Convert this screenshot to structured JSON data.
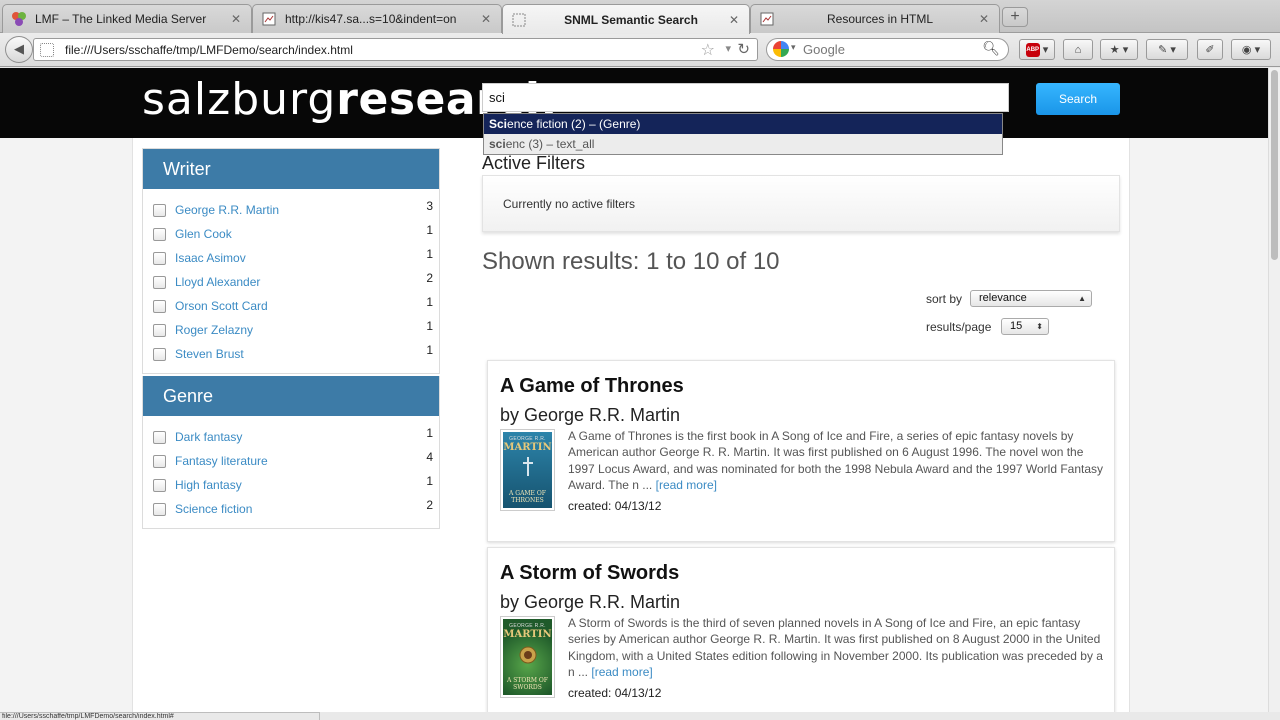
{
  "browser": {
    "tabs": [
      {
        "title": "LMF – The Linked Media Server",
        "favicon": "lmf-icon"
      },
      {
        "title": "http://kis47.sa...s=10&indent=on",
        "favicon": "page-icon"
      },
      {
        "title": "SNML Semantic Search",
        "favicon": "blank-page-icon"
      },
      {
        "title": "Resources in HTML",
        "favicon": "page-icon"
      }
    ],
    "url": "file:///Users/sschaffe/tmp/LMFDemo/search/index.html",
    "search_engine_placeholder": "Google",
    "status_text": "file:///Users/sschaffe/tmp/LMFDemo/search/index.html#"
  },
  "header": {
    "logo_light": "salzburg",
    "logo_bold": "research",
    "query": "sci",
    "search_label": "Search"
  },
  "autocomplete": [
    {
      "match": "Sci",
      "rest": "ence fiction (2) – (Genre)"
    },
    {
      "match": "sci",
      "rest": "enc (3) – text_all"
    }
  ],
  "facets": [
    {
      "title": "Writer",
      "items": [
        {
          "label": "George R.R. Martin",
          "count": "3"
        },
        {
          "label": "Glen Cook",
          "count": "1"
        },
        {
          "label": "Isaac Asimov",
          "count": "1"
        },
        {
          "label": "Lloyd Alexander",
          "count": "2"
        },
        {
          "label": "Orson Scott Card",
          "count": "1"
        },
        {
          "label": "Roger Zelazny",
          "count": "1"
        },
        {
          "label": "Steven Brust",
          "count": "1"
        }
      ]
    },
    {
      "title": "Genre",
      "items": [
        {
          "label": "Dark fantasy",
          "count": "1"
        },
        {
          "label": "Fantasy literature",
          "count": "4"
        },
        {
          "label": "High fantasy",
          "count": "1"
        },
        {
          "label": "Science fiction",
          "count": "2"
        }
      ]
    }
  ],
  "active_filters": {
    "title": "Active Filters",
    "empty_text": "Currently no active filters"
  },
  "results_summary": "Shown results: 1 to 10 of 10",
  "sort": {
    "label": "sort by",
    "value": "relevance"
  },
  "per_page": {
    "label": "results/page",
    "value": "15"
  },
  "results": [
    {
      "title": "A Game of Thrones",
      "author": "by George R.R. Martin",
      "cover": {
        "top": "GEORGE R.R.",
        "name": "MARTIN",
        "sub": "A GAME OF THRONES",
        "color": "#1e6e91"
      },
      "description": "A Game of Thrones is the first book in A Song of Ice and Fire, a series of epic fantasy novels by American author George R. R. Martin. It was first published on 6 August 1996. The novel won the 1997 Locus Award, and was nominated for both the 1998 Nebula Award and the 1997 World Fantasy Award. The n ...",
      "read_more": "[read more]",
      "created": "created: 04/13/12"
    },
    {
      "title": "A Storm of Swords",
      "author": "by George R.R. Martin",
      "cover": {
        "top": "GEORGE R.R.",
        "name": "MARTIN",
        "sub": "A STORM OF SWORDS",
        "color": "#1f5a2a"
      },
      "description": "A Storm of Swords is the third of seven planned novels in A Song of Ice and Fire, an epic fantasy series by American author George R. R. Martin. It was first published on 8 August 2000 in the United Kingdom, with a United States edition following in November 2000. Its publication was preceded by a n ...",
      "read_more": "[read more]",
      "created": "created: 04/13/12"
    }
  ]
}
